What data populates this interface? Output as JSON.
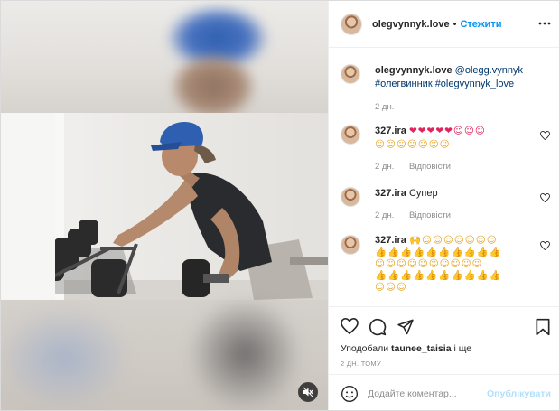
{
  "post": {
    "username": "olegvynnyk.love",
    "follow_label": "Стежити",
    "separator": "•"
  },
  "caption": {
    "username": "olegvynnyk.love",
    "mention": "@olegg.vynnyk",
    "hashtags": "#олегвинник #olegvynnyk_love",
    "time": "2 дн."
  },
  "comments": [
    {
      "username": "327.ira",
      "emoji_line1": "❤❤❤❤❤☺☺☺",
      "emoji_line2": "☺☺☺☺☺☺☺",
      "time": "2 дн.",
      "reply_label": "Відповісти"
    },
    {
      "username": "327.ira",
      "text": "Супер",
      "time": "2 дн.",
      "reply_label": "Відповісти"
    },
    {
      "username": "327.ira",
      "emoji_line1": "🙌☺☺☺☺☺☺☺",
      "emoji_line2": "👍👍👍👍👍👍👍👍👍👍",
      "emoji_line3": "☺☺☺☺☺☺☺☺☺☺",
      "emoji_line4": "👍👍👍👍👍👍👍👍👍👍",
      "emoji_line5": "☺☺☺☺☺☺☺☺☺☺",
      "emoji_line6": "☺☺☺"
    }
  ],
  "likes": {
    "prefix": "Уподобали",
    "user": "taunee_taisia",
    "suffix": "і ще"
  },
  "timestamp": "2 ДН. ТОМУ",
  "comment_box": {
    "placeholder": "Додайте коментар...",
    "publish_label": "Опублікувати"
  },
  "icons": {
    "more": "more-horizontal-icon",
    "like": "heart-icon",
    "comment": "comment-icon",
    "share": "share-icon",
    "save": "bookmark-icon",
    "mute": "speaker-muted-icon",
    "emoji": "smiley-icon"
  },
  "colors": {
    "accent": "#0095f6",
    "publish_disabled": "#b2dffc",
    "muted_text": "#8e8e8e"
  }
}
